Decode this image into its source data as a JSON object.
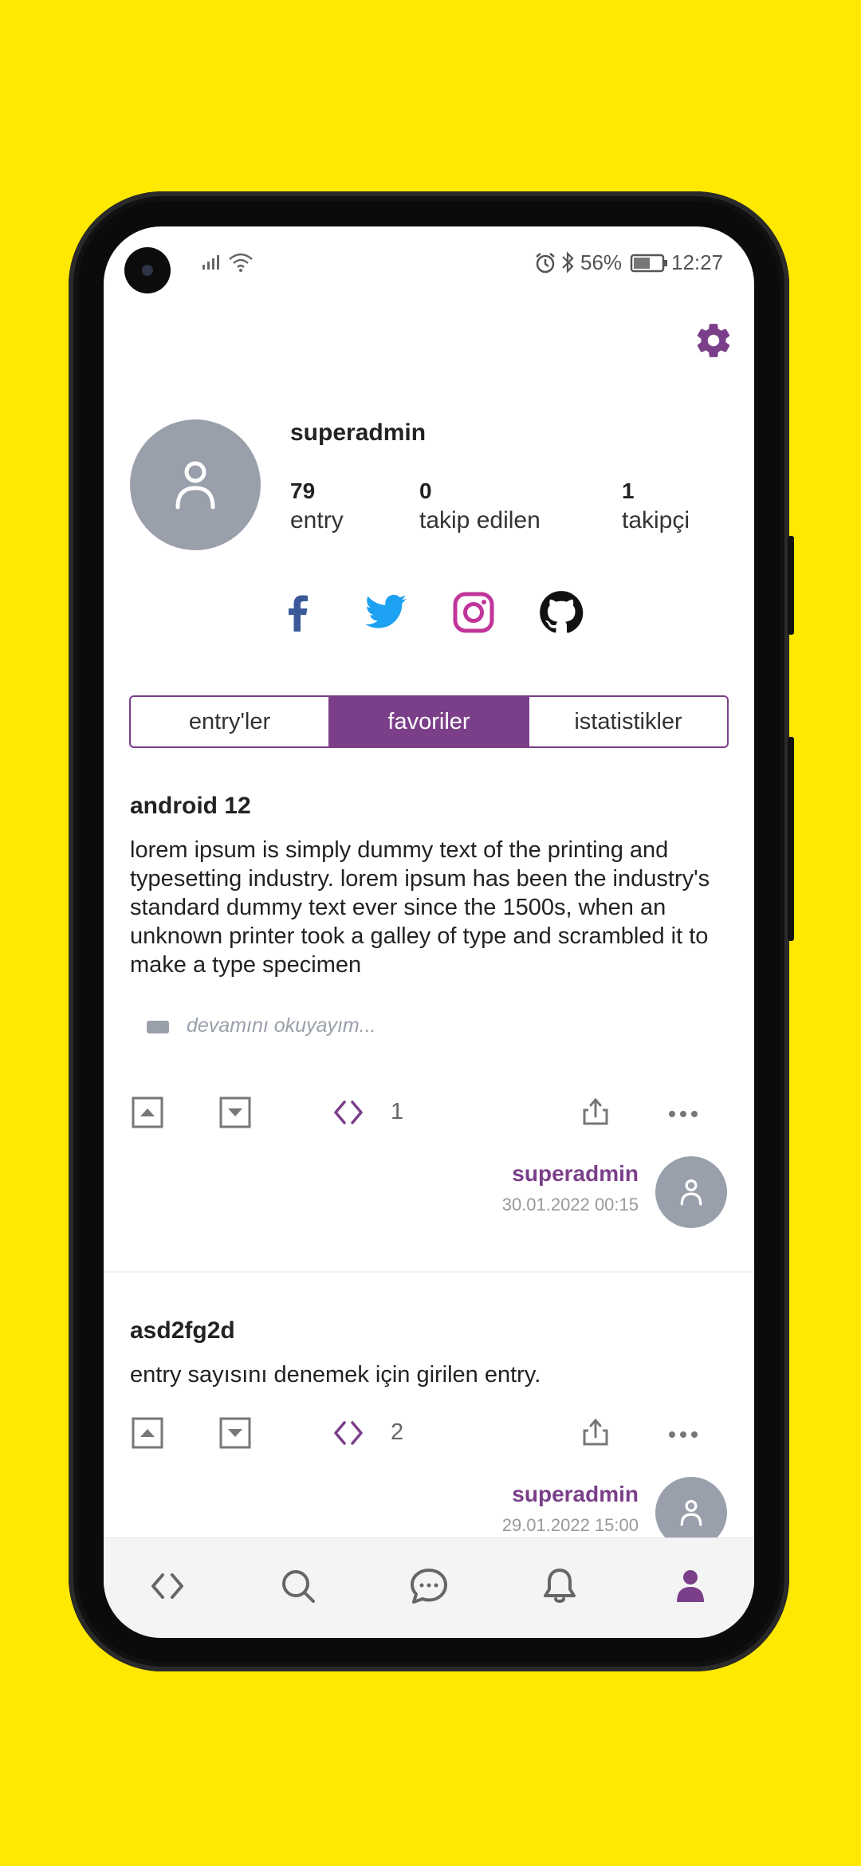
{
  "status_bar": {
    "battery": "56%",
    "time": "12:27"
  },
  "profile": {
    "username": "superadmin",
    "stats": [
      {
        "value": "79",
        "label": "entry"
      },
      {
        "value": "0",
        "label": "takip edilen"
      },
      {
        "value": "1",
        "label": "takipçi"
      }
    ]
  },
  "social": [
    "facebook-icon",
    "twitter-icon",
    "instagram-icon",
    "github-icon"
  ],
  "colors": {
    "accent": "#7B3F8A",
    "avatar_bg": "#9AA0AB",
    "background": "#FFE900"
  },
  "tabs": [
    {
      "label": "entry'ler",
      "active": false
    },
    {
      "label": "favoriler",
      "active": true
    },
    {
      "label": "istatistikler",
      "active": false
    }
  ],
  "entries": [
    {
      "title": "android 12",
      "body": "lorem ipsum is simply dummy text of the printing and typesetting industry. lorem ipsum has been the industry's standard dummy text ever since the 1500s, when an unknown printer took a galley of type and scrambled it to make a type specimen",
      "read_more": "devamını okuyayım...",
      "count": "1",
      "author": "superadmin",
      "date": "30.01.2022 00:15"
    },
    {
      "title": "asd2fg2d",
      "body": "entry sayısını denemek için girilen entry.",
      "count": "2",
      "author": "superadmin",
      "date": "29.01.2022 15:00"
    }
  ],
  "bottom_nav": [
    "code-icon",
    "search-icon",
    "chat-icon",
    "bell-icon",
    "user-icon"
  ]
}
